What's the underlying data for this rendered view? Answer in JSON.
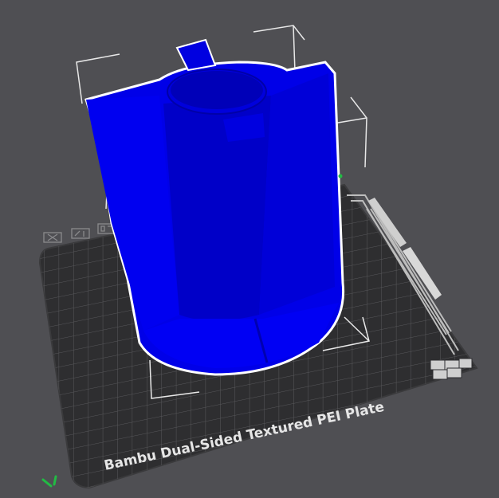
{
  "viewport": {
    "background": "#4f4f53",
    "plate": {
      "label": "Bambu Dual-Sided Textured PEI Plate",
      "color": "#2e2e30",
      "grid_color": "#5a5a5c"
    },
    "model": {
      "color": "#0000e6",
      "outline": "#ffffff"
    },
    "plate_icons": [
      "close-icon",
      "edit-icon",
      "arrange-icon",
      "orient-icon"
    ],
    "axis_icon": "axis-icon"
  }
}
